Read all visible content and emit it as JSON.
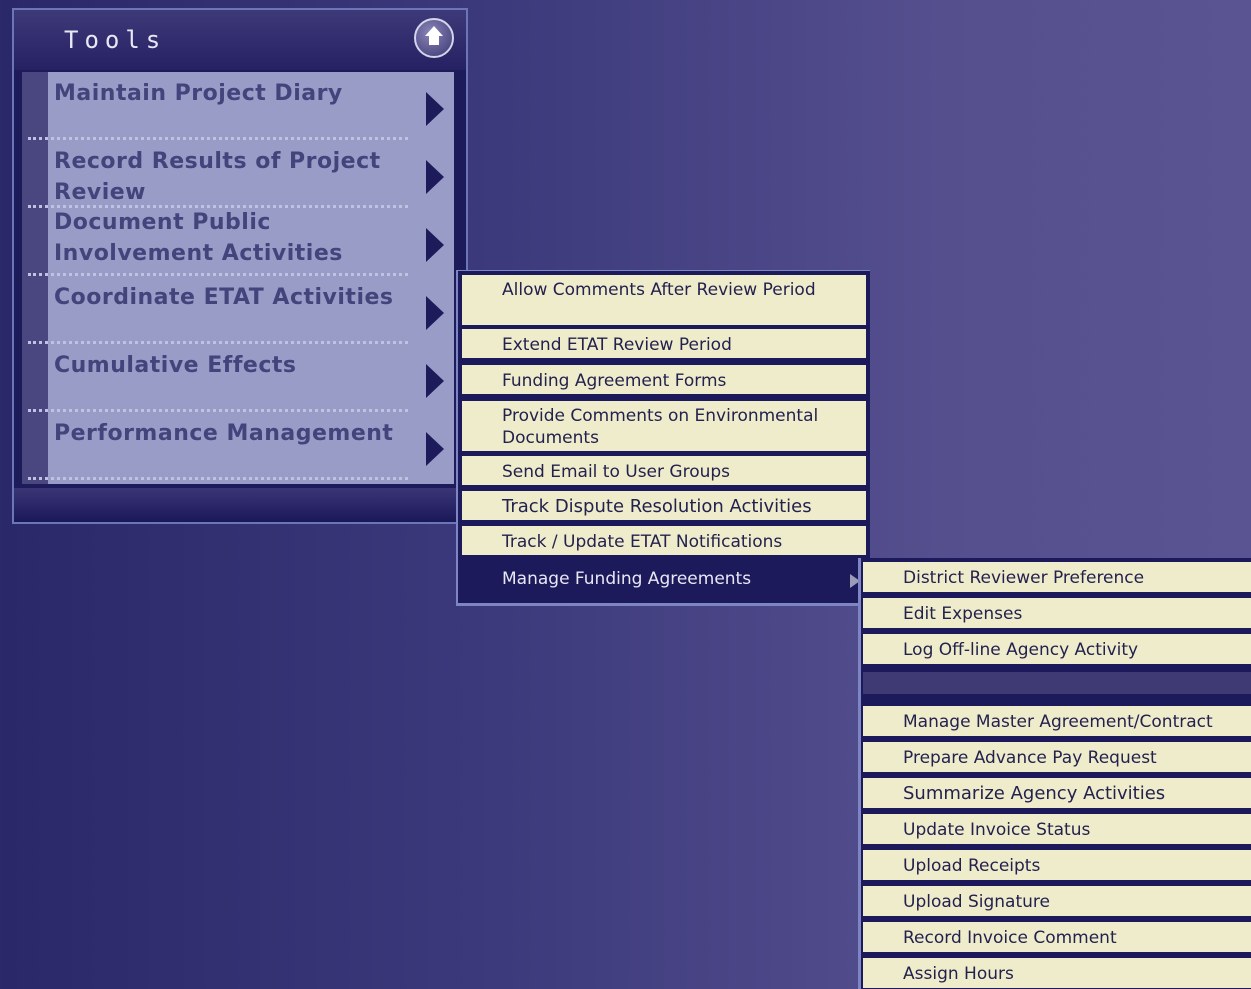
{
  "tools": {
    "title": "Tools",
    "items": [
      {
        "label": "Maintain Project Diary"
      },
      {
        "label": "Record Results of Project Review"
      },
      {
        "label": "Document Public Involvement Activities"
      },
      {
        "label": "Coordinate ETAT Activities"
      },
      {
        "label": "Cumulative Effects"
      },
      {
        "label": "Performance Management"
      }
    ]
  },
  "submenu1": {
    "items": [
      {
        "label": "Allow Comments After Review Period"
      },
      {
        "label": "Extend ETAT Review Period"
      },
      {
        "label": "Funding Agreement Forms"
      },
      {
        "label": "Provide Comments on Environmental Documents"
      },
      {
        "label": "Send Email to User Groups"
      },
      {
        "label": "Track Dispute Resolution Activities"
      },
      {
        "label": "Track / Update ETAT Notifications"
      },
      {
        "label": "Manage Funding Agreements"
      }
    ]
  },
  "submenu2": {
    "items": [
      {
        "label": "District Reviewer Preference"
      },
      {
        "label": "Edit Expenses"
      },
      {
        "label": "Log Off-line Agency Activity"
      },
      {
        "label": "Manage Master Agreement/Contract"
      },
      {
        "label": "Prepare Advance Pay Request"
      },
      {
        "label": "Summarize Agency Activities"
      },
      {
        "label": "Update Invoice Status"
      },
      {
        "label": "Upload Receipts"
      },
      {
        "label": "Upload Signature"
      },
      {
        "label": "Record Invoice Comment"
      },
      {
        "label": "Assign Hours"
      }
    ]
  }
}
